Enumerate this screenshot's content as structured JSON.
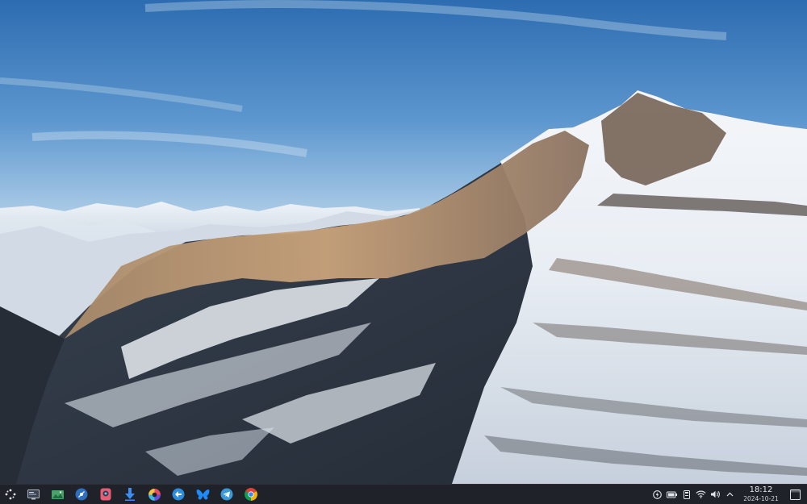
{
  "taskbar": {
    "launcher_icon": "app-launcher-icon",
    "pinned_apps": [
      {
        "name": "system-monitor-icon"
      },
      {
        "name": "image-viewer-icon"
      },
      {
        "name": "network-browser-icon"
      },
      {
        "name": "media-app-icon"
      },
      {
        "name": "download-manager-icon"
      },
      {
        "name": "color-picker-icon"
      },
      {
        "name": "kde-connect-icon"
      },
      {
        "name": "bluesky-icon"
      },
      {
        "name": "telegram-icon"
      },
      {
        "name": "chrome-icon"
      }
    ],
    "tray": {
      "icons": [
        "clipboard-icon",
        "battery-icon",
        "storage-icon",
        "wifi-icon",
        "volume-icon",
        "expand-tray-icon"
      ],
      "clock_time": "18:12",
      "clock_date": "2024-10-21"
    }
  },
  "colors": {
    "taskbar_bg": "#1f2229",
    "sky_top": "#2f6fb3",
    "snow": "#f2f5f8"
  }
}
